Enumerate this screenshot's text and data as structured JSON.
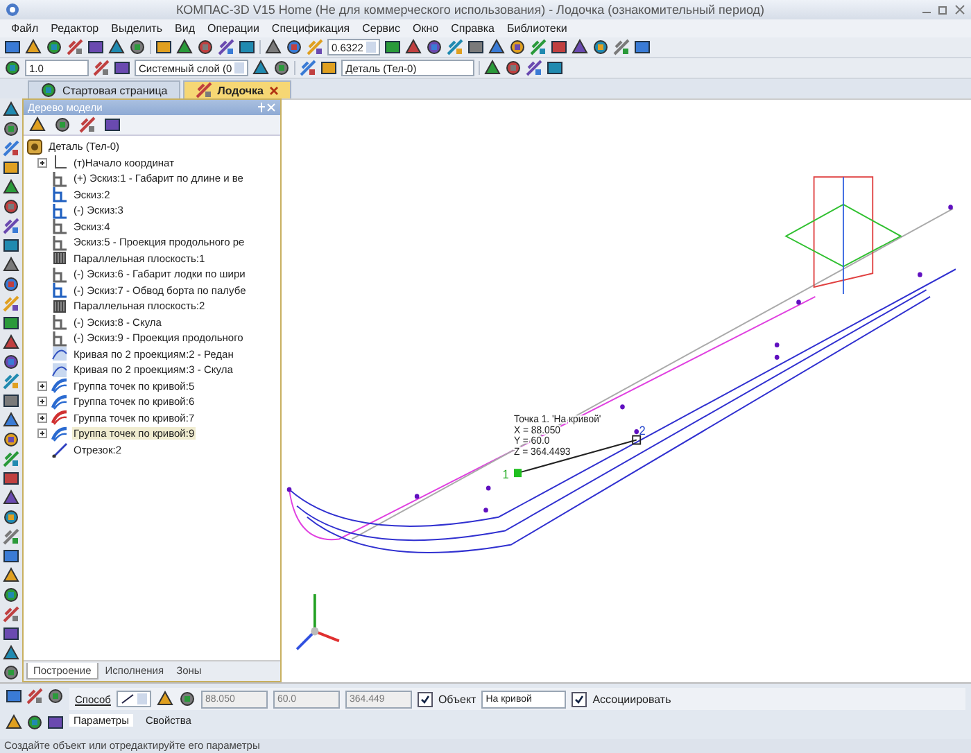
{
  "window": {
    "title": "КОМПАС-3D V15 Home (Не для коммерческого использования) - Лодочка (ознакомительный период)"
  },
  "menu": [
    "Файл",
    "Редактор",
    "Выделить",
    "Вид",
    "Операции",
    "Спецификация",
    "Сервис",
    "Окно",
    "Справка",
    "Библиотеки"
  ],
  "toolbar": {
    "zoom": "0.6322",
    "line_scale": "1.0",
    "layer": "Системный слой (0",
    "body": "Деталь (Тел-0)"
  },
  "doc_tabs": [
    {
      "label": "Стартовая страница",
      "selected": false,
      "closable": false
    },
    {
      "label": "Лодочка",
      "selected": true,
      "closable": true
    }
  ],
  "model_tree": {
    "title": "Дерево модели",
    "root": {
      "label": "Деталь (Тел-0)",
      "kind": "part",
      "children": [
        {
          "label": "(т)Начало координат",
          "kind": "origin",
          "collapsible": true,
          "selected": false
        },
        {
          "label": "(+) Эскиз:1 - Габарит по длине и ве",
          "kind": "sketch",
          "collapsible": false,
          "selected": false
        },
        {
          "label": "Эскиз:2",
          "kind": "sketch-active",
          "collapsible": false,
          "selected": false
        },
        {
          "label": "(-) Эскиз:3",
          "kind": "sketch-active",
          "collapsible": false,
          "selected": false
        },
        {
          "label": "Эскиз:4",
          "kind": "sketch",
          "collapsible": false,
          "selected": false
        },
        {
          "label": "Эскиз:5 - Проекция продольного ре",
          "kind": "sketch",
          "collapsible": false,
          "selected": false
        },
        {
          "label": "Параллельная плоскость:1",
          "kind": "plane",
          "collapsible": false,
          "selected": false
        },
        {
          "label": "(-) Эскиз:6 - Габарит лодки по шири",
          "kind": "sketch",
          "collapsible": false,
          "selected": false
        },
        {
          "label": "(-) Эскиз:7 - Обвод борта по палубе",
          "kind": "sketch-active",
          "collapsible": false,
          "selected": false
        },
        {
          "label": "Параллельная плоскость:2",
          "kind": "plane",
          "collapsible": false,
          "selected": false
        },
        {
          "label": "(-) Эскиз:8 - Скула",
          "kind": "sketch",
          "collapsible": false,
          "selected": false
        },
        {
          "label": "(-) Эскиз:9 - Проекция продольного",
          "kind": "sketch",
          "collapsible": false,
          "selected": false
        },
        {
          "label": "Кривая по 2 проекциям:2 - Редан",
          "kind": "curve",
          "collapsible": false,
          "selected": false
        },
        {
          "label": "Кривая по 2 проекциям:3 - Скула",
          "kind": "curve",
          "collapsible": false,
          "selected": false
        },
        {
          "label": "Группа точек по кривой:5",
          "kind": "group",
          "collapsible": true,
          "selected": false
        },
        {
          "label": "Группа точек по кривой:6",
          "kind": "group",
          "collapsible": true,
          "selected": false
        },
        {
          "label": "Группа точек по кривой:7",
          "kind": "group-error",
          "collapsible": true,
          "selected": false
        },
        {
          "label": "Группа точек по кривой:9",
          "kind": "group",
          "collapsible": true,
          "selected": true
        },
        {
          "label": "Отрезок:2",
          "kind": "segment",
          "collapsible": false,
          "selected": false
        }
      ]
    },
    "tabs": [
      {
        "label": "Построение",
        "selected": true
      },
      {
        "label": "Исполнения",
        "selected": false
      },
      {
        "label": "Зоны",
        "selected": false
      }
    ]
  },
  "canvas": {
    "annotation": [
      "Точка 1. 'На кривой'",
      "X = 88.050",
      "Y = 60.0",
      "Z = 364.4493"
    ],
    "point_labels": [
      {
        "label": "1",
        "color": "#22aa22"
      },
      {
        "label": "2",
        "color": "#2244cc"
      }
    ]
  },
  "property_panel": {
    "method_label": "Способ",
    "coords": [
      {
        "value": "88.050",
        "disabled": true
      },
      {
        "value": "60.0",
        "disabled": true
      },
      {
        "value": "364.449",
        "disabled": true
      }
    ],
    "object": {
      "label": "Объект",
      "checked": true,
      "value": "На кривой"
    },
    "associate": {
      "label": "Ассоциировать",
      "checked": true
    },
    "tabs": [
      {
        "label": "Параметры",
        "selected": true
      },
      {
        "label": "Свойства",
        "selected": false
      }
    ]
  },
  "status_bar": "Создайте объект или отредактируйте его параметры"
}
